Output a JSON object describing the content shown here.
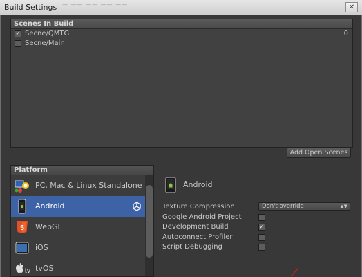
{
  "window": {
    "title": "Build Settings",
    "ghost_menu": "—  ——  ——  ——  ——"
  },
  "scenes": {
    "header": "Scenes In Build",
    "items": [
      {
        "name": "Secne/QMTG",
        "checked": true,
        "index": "0"
      },
      {
        "name": "Secne/Main",
        "checked": false,
        "index": ""
      }
    ],
    "add_button": "Add Open Scenes"
  },
  "platform": {
    "title": "Platform",
    "items": [
      {
        "label": "PC, Mac & Linux Standalone",
        "icon": "pc-standalone-icon",
        "selected": false
      },
      {
        "label": "Android",
        "icon": "android-icon",
        "selected": true
      },
      {
        "label": "WebGL",
        "icon": "html5-icon",
        "selected": false
      },
      {
        "label": "iOS",
        "icon": "ios-device-icon",
        "selected": false
      },
      {
        "label": "tvOS",
        "icon": "apple-tv-icon",
        "selected": false
      }
    ]
  },
  "settings": {
    "title": "Android",
    "texture_compression": {
      "label": "Texture Compression",
      "value": "Don't override"
    },
    "options": [
      {
        "label": "Google Android Project",
        "checked": false
      },
      {
        "label": "Development Build",
        "checked": true
      },
      {
        "label": "Autoconnect Profiler",
        "checked": false
      },
      {
        "label": "Script Debugging",
        "checked": false
      }
    ]
  },
  "colors": {
    "selected": "#3d62a6",
    "panel": "#383838",
    "list": "#414141"
  }
}
